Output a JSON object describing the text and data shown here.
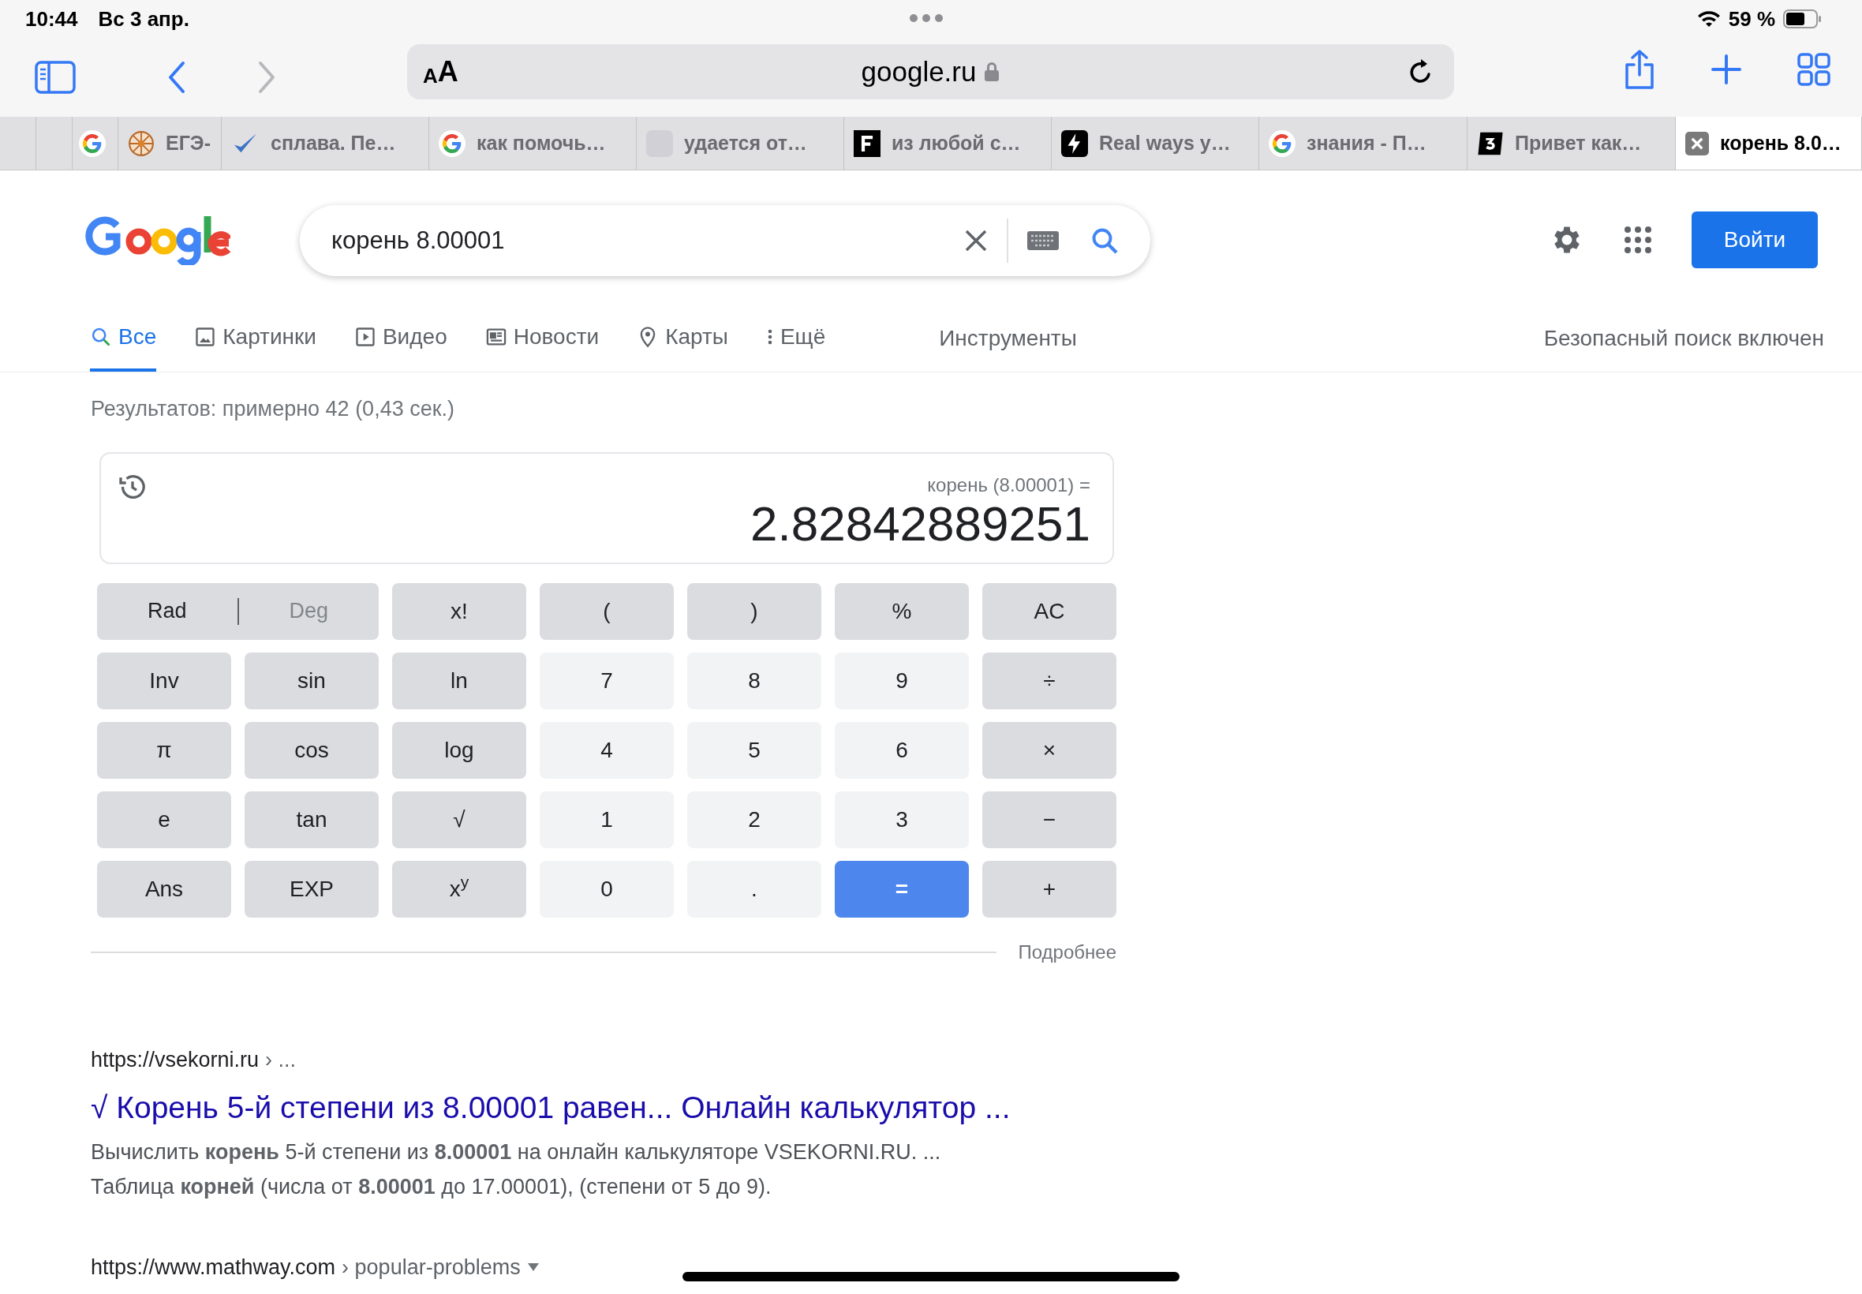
{
  "status_bar": {
    "time": "10:44",
    "date": "Вс 3 апр.",
    "battery": "59 %"
  },
  "toolbar": {
    "text_size_small": "A",
    "text_size_large": "A",
    "domain": "google.ru"
  },
  "tabs": [
    {
      "kind": "google",
      "selected": false
    },
    {
      "kind": "wheel",
      "label": "ЕГЭ-",
      "selected": false
    },
    {
      "kind": "check",
      "label": "сплава. Пе…",
      "selected": false
    },
    {
      "kind": "google",
      "label": "как помочь…",
      "selected": false
    },
    {
      "kind": "tile",
      "label": "удается от…",
      "selected": false
    },
    {
      "kind": "serif",
      "label": "из любой с…",
      "selected": false
    },
    {
      "kind": "bolt",
      "label": "Real ways y…",
      "selected": false
    },
    {
      "kind": "google",
      "label": "знания - П…",
      "selected": false
    },
    {
      "kind": "three",
      "label": "Привет как…",
      "selected": false
    },
    {
      "kind": "closebox",
      "label": "корень 8.0…",
      "selected": true
    }
  ],
  "search": {
    "value": "корень 8.00001",
    "sign_in": "Войти"
  },
  "nav": [
    {
      "kind": "search",
      "label": "Все",
      "selected": true
    },
    {
      "kind": "image",
      "label": "Картинки",
      "selected": false
    },
    {
      "kind": "video",
      "label": "Видео",
      "selected": false
    },
    {
      "kind": "news",
      "label": "Новости",
      "selected": false
    },
    {
      "kind": "pin",
      "label": "Карты",
      "selected": false
    },
    {
      "kind": "more",
      "label": "Ещё",
      "selected": false
    }
  ],
  "tools": "Инструменты",
  "safe_search": "Безопасный поиск включен",
  "result_stats": "Результатов: примерно 42 (0,43 сек.)",
  "calculator": {
    "expression": "корень (8.00001) =",
    "result": "2.82842889251",
    "mode": [
      {
        "label": "Rad",
        "selected": true
      },
      {
        "label": "Deg",
        "selected": false
      }
    ],
    "keys": [
      {
        "label": "x!",
        "kind": "func"
      },
      {
        "label": "(",
        "kind": "func"
      },
      {
        "label": ")",
        "kind": "func"
      },
      {
        "label": "%",
        "kind": "func"
      },
      {
        "label": "AC",
        "kind": "func"
      },
      {
        "label": "Inv",
        "kind": "func"
      },
      {
        "label": "sin",
        "kind": "func"
      },
      {
        "label": "ln",
        "kind": "func"
      },
      {
        "label": "7",
        "kind": "num"
      },
      {
        "label": "8",
        "kind": "num"
      },
      {
        "label": "9",
        "kind": "num"
      },
      {
        "label": "÷",
        "kind": "func"
      },
      {
        "label": "π",
        "kind": "func"
      },
      {
        "label": "cos",
        "kind": "func"
      },
      {
        "label": "log",
        "kind": "func"
      },
      {
        "label": "4",
        "kind": "num"
      },
      {
        "label": "5",
        "kind": "num"
      },
      {
        "label": "6",
        "kind": "num"
      },
      {
        "label": "×",
        "kind": "func"
      },
      {
        "label": "e",
        "kind": "func"
      },
      {
        "label": "tan",
        "kind": "func"
      },
      {
        "label": "√",
        "kind": "func"
      },
      {
        "label": "1",
        "kind": "num"
      },
      {
        "label": "2",
        "kind": "num"
      },
      {
        "label": "3",
        "kind": "num"
      },
      {
        "label": "−",
        "kind": "func"
      },
      {
        "label": "Ans",
        "kind": "func"
      },
      {
        "label": "EXP",
        "kind": "func"
      },
      {
        "label": "x$^{y}$",
        "kind": "func"
      },
      {
        "label": "0",
        "kind": "num"
      },
      {
        "label": ".",
        "kind": "num"
      },
      {
        "label": "=",
        "kind": "equals"
      },
      {
        "label": "+",
        "kind": "func"
      }
    ],
    "more": "Подробнее"
  },
  "results": [
    {
      "url": "https://vsekorni.ru",
      "path": "› ...",
      "title": "√ Корень 5-й степени из 8.00001 равен... Онлайн калькулятор ...",
      "snippet": [
        "Вычислить **корень** 5-й степени из **8.00001** на онлайн калькуляторе VSEKORNI.RU. ...",
        "Таблица **корней** (числа от **8.00001** до 17.00001), (степени от 5 до 9)."
      ]
    },
    {
      "url": "https://www.mathway.com",
      "path": "› popular-problems"
    }
  ]
}
